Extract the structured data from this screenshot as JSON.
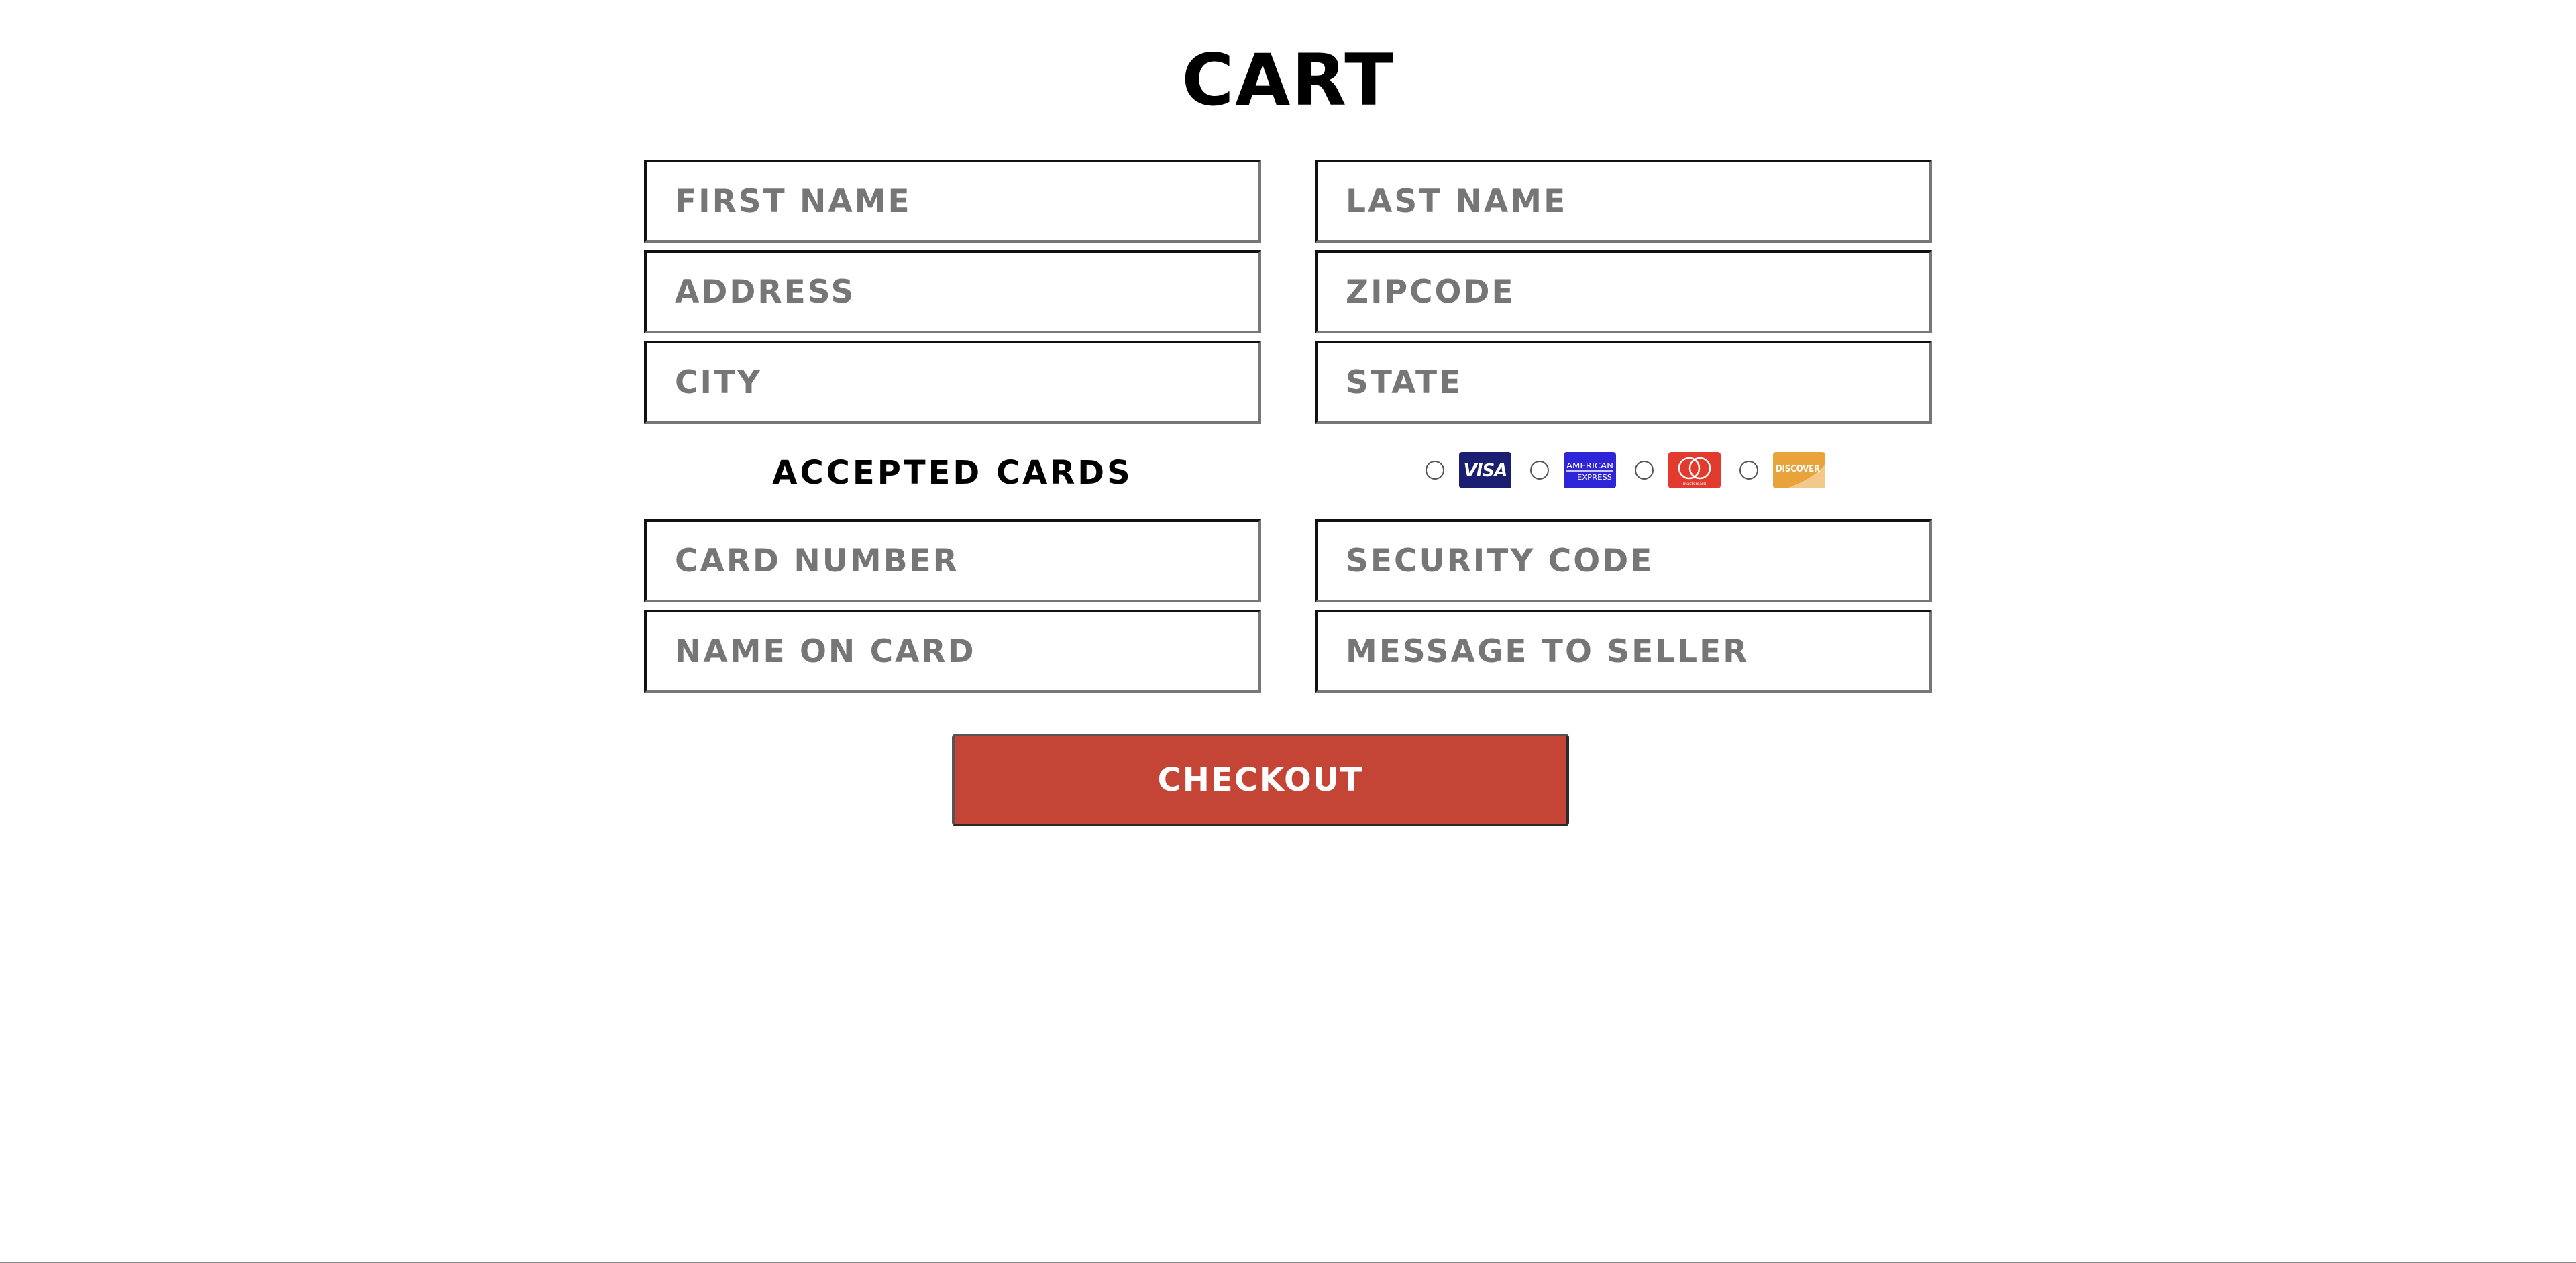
{
  "page": {
    "title": "CART"
  },
  "form": {
    "fields": {
      "first_name": {
        "placeholder": "FIRST NAME",
        "value": ""
      },
      "last_name": {
        "placeholder": "LAST NAME",
        "value": ""
      },
      "address": {
        "placeholder": "ADDRESS",
        "value": ""
      },
      "zipcode": {
        "placeholder": "ZIPCODE",
        "value": ""
      },
      "city": {
        "placeholder": "CITY",
        "value": ""
      },
      "state": {
        "placeholder": "STATE",
        "value": ""
      },
      "card_number": {
        "placeholder": "CARD NUMBER",
        "value": ""
      },
      "security_code": {
        "placeholder": "SECURITY CODE",
        "value": ""
      },
      "name_on_card": {
        "placeholder": "NAME ON CARD",
        "value": ""
      },
      "message_to_seller": {
        "placeholder": "MESSAGE TO SELLER",
        "value": ""
      }
    },
    "accepted_cards_label": "ACCEPTED CARDS",
    "cards": [
      {
        "icon": "visa-icon",
        "text": "VISA",
        "color": "#1a1f71",
        "selected": false
      },
      {
        "icon": "american-express-icon",
        "text": "AMERICAN EXPRESS",
        "color": "#2e25d8",
        "selected": false
      },
      {
        "icon": "mastercard-icon",
        "text": "mastercard",
        "color": "#e23a2d",
        "selected": false
      },
      {
        "icon": "discover-icon",
        "text": "DISCOVER",
        "color": "#e8a33a",
        "selected": false
      }
    ],
    "checkout_label": "CHECKOUT"
  },
  "colors": {
    "checkout_button": "#c44536",
    "field_border": "#111111",
    "placeholder_text": "#767676"
  }
}
